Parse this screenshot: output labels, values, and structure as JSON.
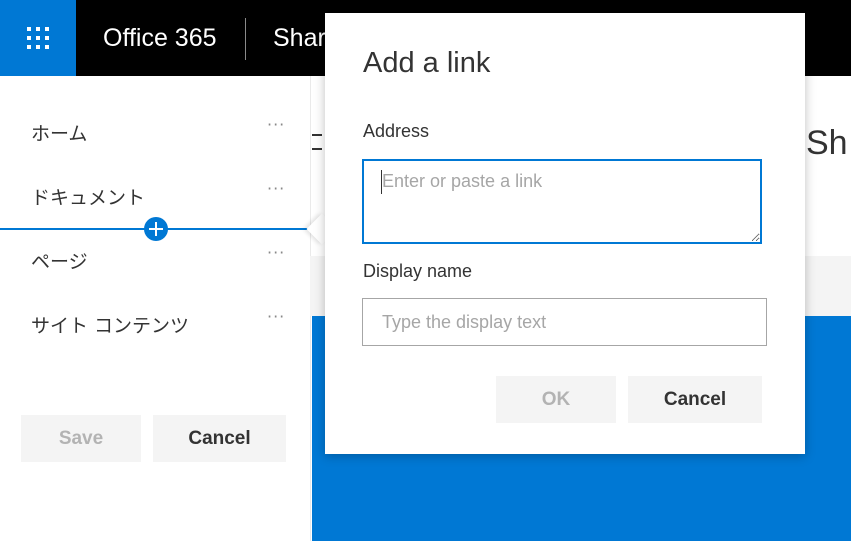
{
  "topbar": {
    "app_launcher_icon": "waffle-grid-icon",
    "brand": "Office 365",
    "site_link": "Shar"
  },
  "nav": {
    "items": [
      {
        "label": "ホーム",
        "more": "···"
      },
      {
        "label": "ドキュメント",
        "more": "···"
      },
      {
        "label": "ページ",
        "more": "···"
      },
      {
        "label": "サイト コンテンツ",
        "more": "···"
      }
    ],
    "insert_icon": "plus-circle-icon",
    "save_label": "Save",
    "cancel_label": "Cancel"
  },
  "main": {
    "title_fragment": "Sh"
  },
  "dialog": {
    "title": "Add a link",
    "address_label": "Address",
    "address_value": "",
    "address_placeholder": "Enter or paste a link",
    "display_label": "Display name",
    "display_value": "",
    "display_placeholder": "Type the display text",
    "ok_label": "OK",
    "cancel_label": "Cancel"
  },
  "colors": {
    "accent": "#0078d4",
    "topbar_bg": "#000000",
    "button_bg": "#f4f4f4",
    "disabled_text": "#b3b3b3"
  }
}
